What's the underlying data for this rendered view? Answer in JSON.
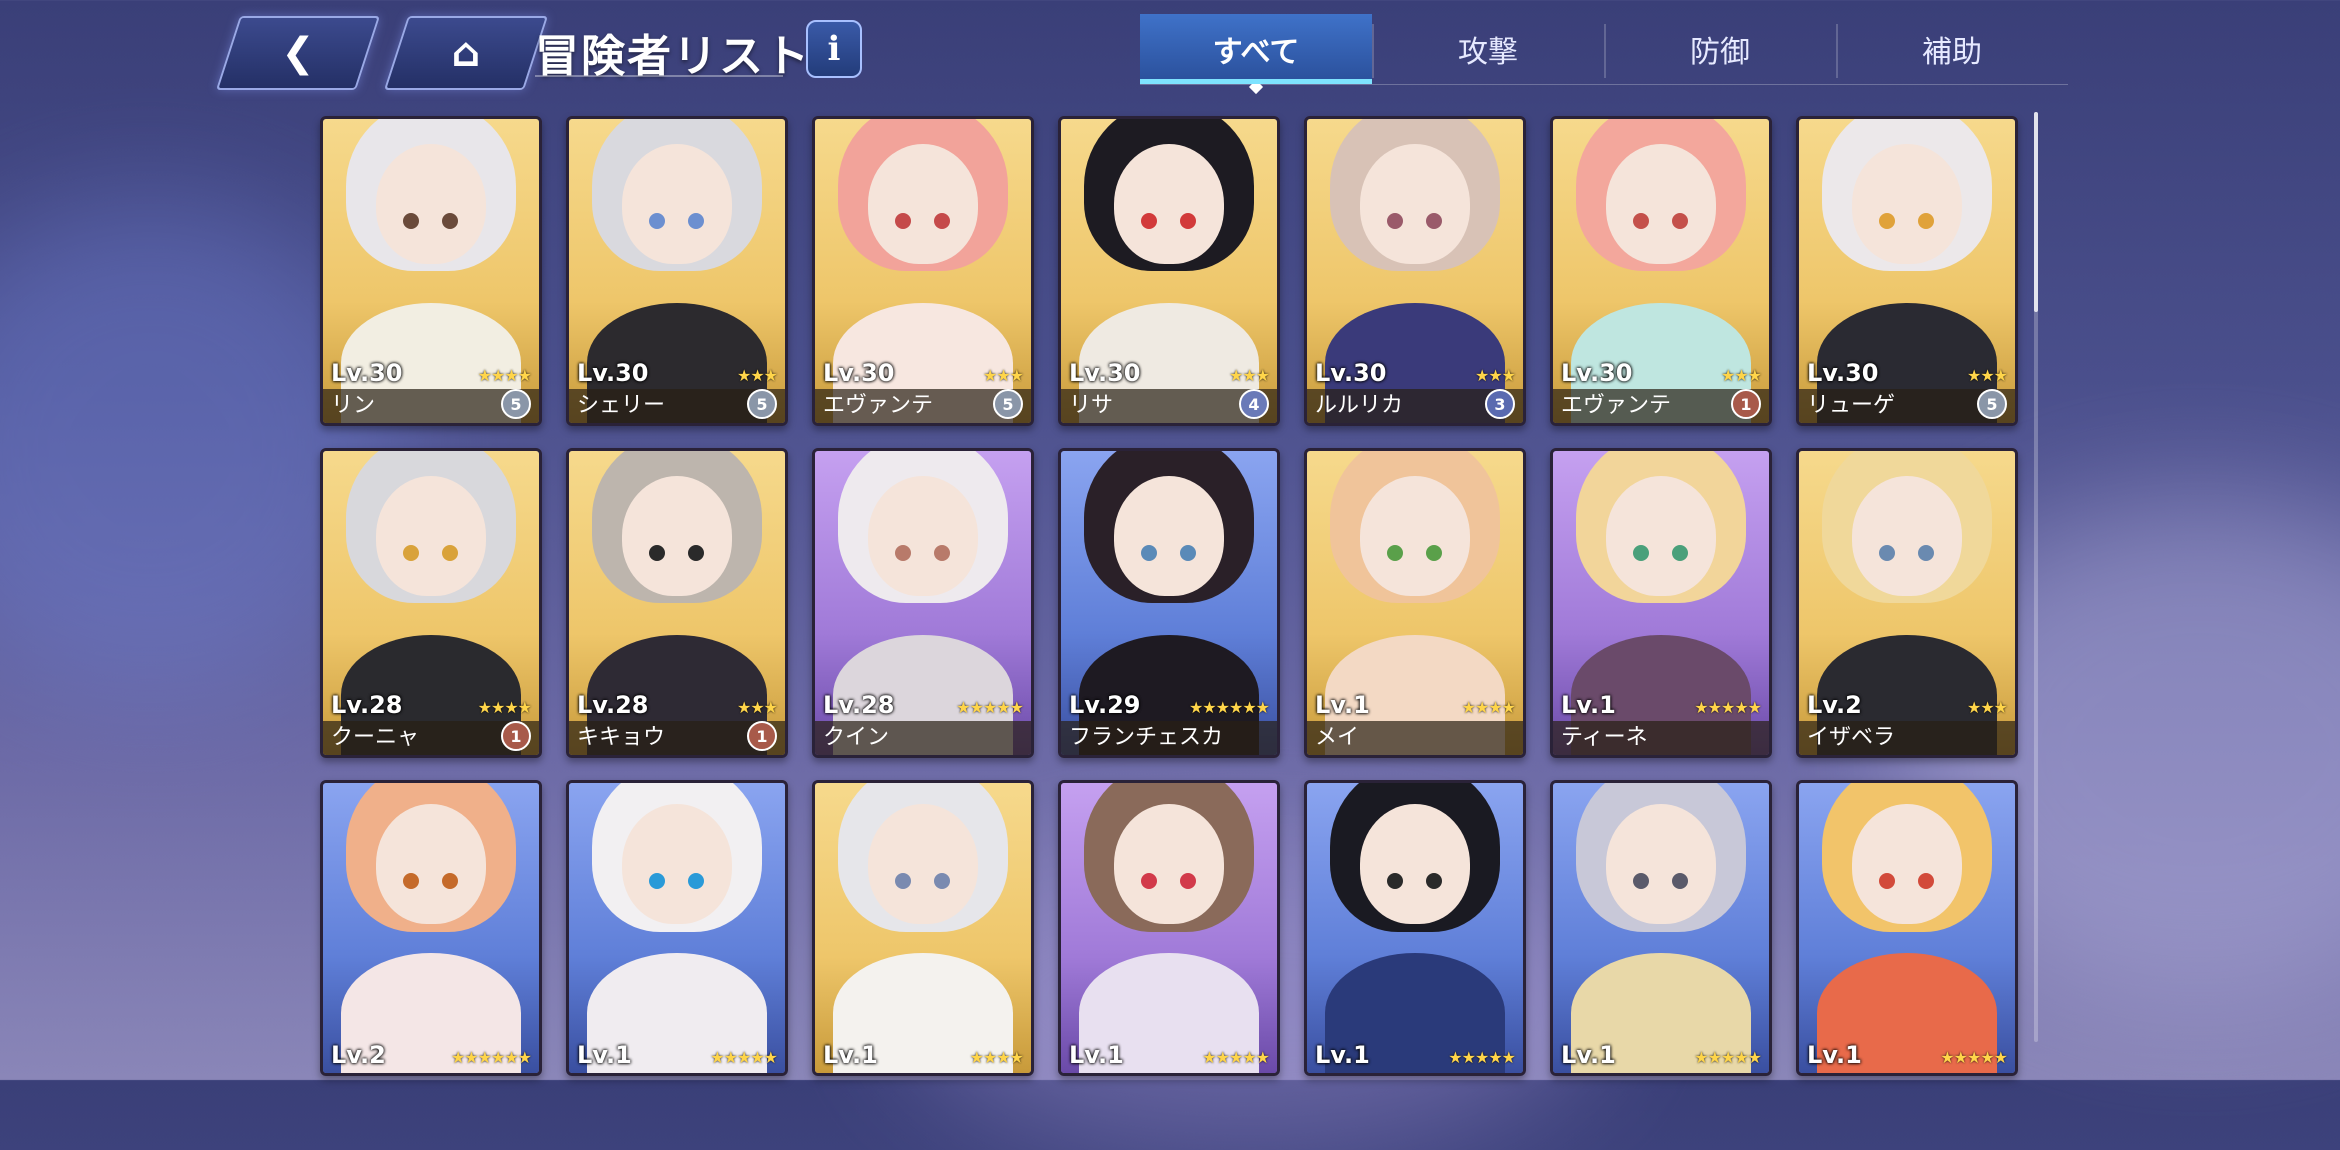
{
  "header": {
    "title": "冒険者リスト",
    "back_icon": "back-arrow-icon",
    "home_icon": "home-icon",
    "info_label": "i"
  },
  "tabs": [
    {
      "label": "すべて",
      "active": true
    },
    {
      "label": "攻撃",
      "active": false
    },
    {
      "label": "防御",
      "active": false
    },
    {
      "label": "補助",
      "active": false
    }
  ],
  "cards": [
    {
      "name": "リン",
      "level": "Lv.30",
      "stars": "★★★★",
      "badge": "5",
      "frame": "gold",
      "hair": "#e8e6ea",
      "eye": "#6a4a3a",
      "outfit": "#f2eee2"
    },
    {
      "name": "シェリー",
      "level": "Lv.30",
      "stars": "★★★",
      "badge": "5",
      "frame": "gold",
      "hair": "#d9d9de",
      "eye": "#6c8fd0",
      "outfit": "#2c2a2e"
    },
    {
      "name": "エヴァンテ",
      "level": "Lv.30",
      "stars": "★★★",
      "badge": "5",
      "frame": "gold",
      "hair": "#f2a39a",
      "eye": "#c54a4a",
      "outfit": "#f7e7e0"
    },
    {
      "name": "リサ",
      "level": "Lv.30",
      "stars": "★★★",
      "badge": "4",
      "frame": "gold",
      "hair": "#1d1b22",
      "eye": "#d23a3a",
      "outfit": "#efeae2"
    },
    {
      "name": "ルルリカ",
      "level": "Lv.30",
      "stars": "★★★",
      "badge": "3",
      "frame": "gold",
      "hair": "#d8c2b6",
      "eye": "#9a5a6a",
      "outfit": "#3a3a7a"
    },
    {
      "name": "エヴァンテ",
      "level": "Lv.30",
      "stars": "★★★",
      "badge": "1",
      "frame": "gold",
      "hair": "#f3a79c",
      "eye": "#c4504a",
      "outfit": "#bfe6e0"
    },
    {
      "name": "リューゲ",
      "level": "Lv.30",
      "stars": "★★★",
      "badge": "5",
      "frame": "gold",
      "hair": "#ece8ea",
      "eye": "#e0a23a",
      "outfit": "#2a2a32"
    },
    {
      "name": "クーニャ",
      "level": "Lv.28",
      "stars": "★★★★",
      "badge": "1",
      "frame": "gold",
      "hair": "#d8d8dc",
      "eye": "#d9a23a",
      "outfit": "#2a2a2e"
    },
    {
      "name": "キキョウ",
      "level": "Lv.28",
      "stars": "★★★",
      "badge": "1",
      "frame": "gold",
      "hair": "#bdb5ad",
      "eye": "#2a2a2a",
      "outfit": "#2e2a34"
    },
    {
      "name": "クイン",
      "level": "Lv.28",
      "stars": "★★★★★",
      "badge": "",
      "frame": "purple",
      "hair": "#eeeaee",
      "eye": "#b87a6a",
      "outfit": "#dcd6dc"
    },
    {
      "name": "フランチェスカ",
      "level": "Lv.29",
      "stars": "★★★★★★",
      "badge": "",
      "frame": "blue",
      "hair": "#2a2028",
      "eye": "#5a8ab8",
      "outfit": "#1e1a22"
    },
    {
      "name": "メイ",
      "level": "Lv.1",
      "stars": "★★★★",
      "badge": "",
      "frame": "gold",
      "hair": "#f0c49a",
      "eye": "#5aa04a",
      "outfit": "#f3d9c4"
    },
    {
      "name": "ティーネ",
      "level": "Lv.1",
      "stars": "★★★★★",
      "badge": "",
      "frame": "purple",
      "hair": "#f2d59a",
      "eye": "#4aa07a",
      "outfit": "#6a4a6a"
    },
    {
      "name": "イザベラ",
      "level": "Lv.2",
      "stars": "★★★",
      "badge": "",
      "frame": "gold",
      "hair": "#f0d89a",
      "eye": "#6a8ab0",
      "outfit": "#2a2a30"
    },
    {
      "name": "",
      "level": "Lv.2",
      "stars": "★★★★★★",
      "badge": "",
      "frame": "blue",
      "hair": "#f0b08a",
      "eye": "#c56a2a",
      "outfit": "#f4e6e6"
    },
    {
      "name": "",
      "level": "Lv.1",
      "stars": "★★★★★",
      "badge": "",
      "frame": "blue",
      "hair": "#f2f0f2",
      "eye": "#2a9ad8",
      "outfit": "#f0ecf0"
    },
    {
      "name": "",
      "level": "Lv.1",
      "stars": "★★★★",
      "badge": "",
      "frame": "gold",
      "hair": "#e6e6ea",
      "eye": "#7a8ab0",
      "outfit": "#f4f2ee"
    },
    {
      "name": "",
      "level": "Lv.1",
      "stars": "★★★★★",
      "badge": "",
      "frame": "purple",
      "hair": "#8a6a5a",
      "eye": "#d23a4a",
      "outfit": "#e8e0f0"
    },
    {
      "name": "",
      "level": "Lv.1",
      "stars": "★★★★★",
      "badge": "",
      "frame": "blue",
      "hair": "#1a1a22",
      "eye": "#2a2a2a",
      "outfit": "#2a3a7a"
    },
    {
      "name": "",
      "level": "Lv.1",
      "stars": "★★★★★",
      "badge": "",
      "frame": "blue",
      "hair": "#c8c8d8",
      "eye": "#5a5a6a",
      "outfit": "#e8d8a8"
    },
    {
      "name": "",
      "level": "Lv.1",
      "stars": "★★★★★",
      "badge": "",
      "frame": "blue",
      "hair": "#f2c46a",
      "eye": "#d24a3a",
      "outfit": "#e86a4a"
    }
  ],
  "colors": {
    "gold_frame": "#f3cf7a",
    "purple_frame": "#b088e0",
    "blue_frame": "#6a8ae0",
    "tab_active": "#3f72c9",
    "star": "#ffd54a"
  }
}
